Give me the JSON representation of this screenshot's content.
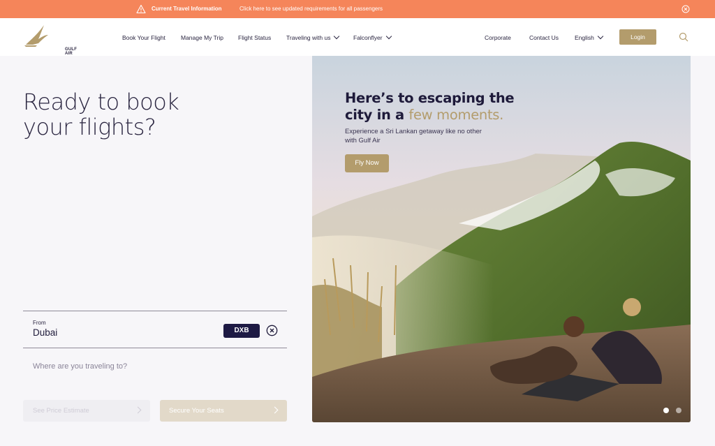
{
  "alert": {
    "title": "Current Travel Information",
    "text": "Click here to see updated requirements for all passengers",
    "icon": "warning-icon",
    "close_icon": "close-circle-icon"
  },
  "header": {
    "logo_text": "GULF AIR",
    "nav": [
      "Book Your Flight",
      "Manage My Trip",
      "Flight Status",
      "Traveling with us",
      "Falconflyer",
      "Corporate",
      "Contact Us",
      "English"
    ],
    "login_label": "Login",
    "search_icon": "search-icon"
  },
  "booking": {
    "headline": [
      "Ready to book",
      "your flights?"
    ],
    "from_label": "From",
    "from_city": "Dubai",
    "from_code": "DXB",
    "to_placeholder": "Where are you traveling to?",
    "estimate_label": "See Price Estimate",
    "secure_label": "Secure Your Seats"
  },
  "hero": {
    "title_line1": "Here’s to escaping the",
    "title_line2_start": "city in a ",
    "title_line2_highlight": "few moments.",
    "subtitle": "Experience a Sri Lankan getaway like no other with Gulf Air",
    "cta_label": "Fly Now",
    "slides_total": 2,
    "slide_active": 1
  },
  "colors": {
    "accent_gold": "#b39c6c",
    "alert_orange": "#f5855a",
    "navy": "#1e1a44",
    "text_dark": "#2a2540"
  }
}
